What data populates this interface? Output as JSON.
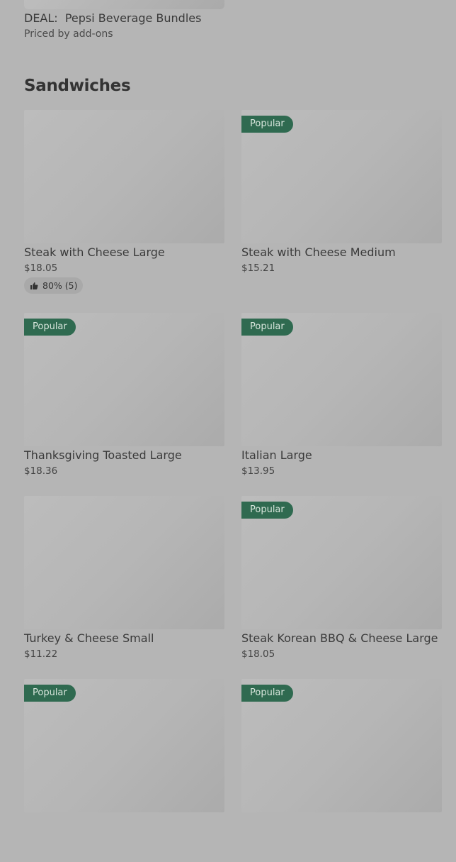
{
  "deal": {
    "title": "DEAL:  Pepsi Beverage Bundles",
    "subtitle": "Priced by add-ons"
  },
  "section": {
    "title": "Sandwiches"
  },
  "items": [
    {
      "name": "Steak with Cheese Large",
      "price": "$18.05",
      "popular": false,
      "rating": "80% (5)"
    },
    {
      "name": "Steak with Cheese Medium",
      "price": "$15.21",
      "popular": true,
      "badge": "Popular"
    },
    {
      "name": "Thanksgiving Toasted Large",
      "price": "$18.36",
      "popular": true,
      "badge": "Popular"
    },
    {
      "name": "Italian Large",
      "price": "$13.95",
      "popular": true,
      "badge": "Popular"
    },
    {
      "name": "Turkey & Cheese Small",
      "price": "$11.22",
      "popular": false
    },
    {
      "name": "Steak Korean BBQ & Cheese Large",
      "price": "$18.05",
      "popular": true,
      "badge": "Popular"
    },
    {
      "name": "",
      "price": "",
      "popular": true,
      "badge": "Popular"
    },
    {
      "name": "",
      "price": "",
      "popular": true,
      "badge": "Popular"
    }
  ],
  "icons": {
    "rating": "thumbs-up-icon"
  }
}
